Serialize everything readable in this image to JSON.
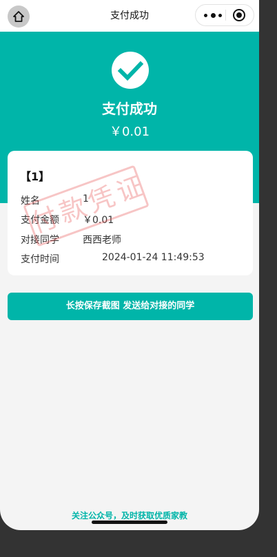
{
  "navbar": {
    "title": "支付成功",
    "home_icon": "home-icon",
    "menu_icon": "more-dots-icon",
    "close_icon": "target-close-icon"
  },
  "hero": {
    "icon": "check-icon",
    "title": "支付成功",
    "amount": "￥0.01",
    "background": "#00b5a9"
  },
  "card": {
    "title": "【1】",
    "stamp_text": "付款凭证",
    "rows": [
      {
        "label": "姓名",
        "value": "1"
      },
      {
        "label": "支付金额",
        "value": "￥0.01"
      },
      {
        "label": "对接同学",
        "value": "西西老师"
      },
      {
        "label": "支付时间",
        "value": "2024-01-24 11:49:53"
      }
    ]
  },
  "action": {
    "label": "长按保存截图 发送给对接的同学"
  },
  "footer": {
    "link": "关注公众号，及时获取优质家教"
  },
  "colors": {
    "accent": "#00b5a9",
    "stamp": "#e85a5a"
  }
}
